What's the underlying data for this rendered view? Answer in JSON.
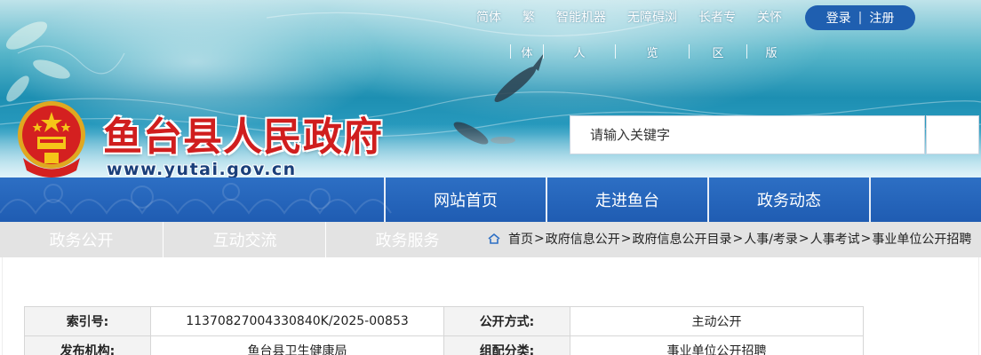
{
  "header": {
    "site_title": "鱼台县人民政府",
    "site_url": "www.yutai.gov.cn",
    "top_links": [
      "简体",
      "繁",
      "智能机器",
      "无障碍浏",
      "长者专",
      "关怀"
    ],
    "login_label": "登录",
    "login_separator": "|",
    "register_label": "注册",
    "sub_row": [
      "体",
      "人",
      "览",
      "区",
      "版"
    ],
    "search": {
      "placeholder": "请输入关键字"
    }
  },
  "main_nav": {
    "tabs": [
      "网站首页",
      "走进鱼台",
      "政务动态"
    ]
  },
  "sub_nav": {
    "tabs": [
      "政务公开",
      "互动交流",
      "政务服务"
    ]
  },
  "breadcrumb": {
    "items": [
      "首页",
      "政府信息公开",
      "政府信息公开目录",
      "人事/考录",
      "人事考试",
      "事业单位公开招聘"
    ],
    "separator": ">"
  },
  "info_table": {
    "rows": [
      {
        "label1": "索引号:",
        "value1": "11370827004330840K/2025-00853",
        "label2": "公开方式:",
        "value2": "主动公开"
      },
      {
        "label1": "发布机构:",
        "value1": "鱼台县卫生健康局",
        "label2": "组配分类:",
        "value2": "事业单位公开招聘"
      }
    ]
  },
  "colors": {
    "title_red": "#d01e1e",
    "nav_blue": "#1f5cb2",
    "login_blue": "#1f5fb0",
    "subnav_gray": "#e3e3e3"
  }
}
